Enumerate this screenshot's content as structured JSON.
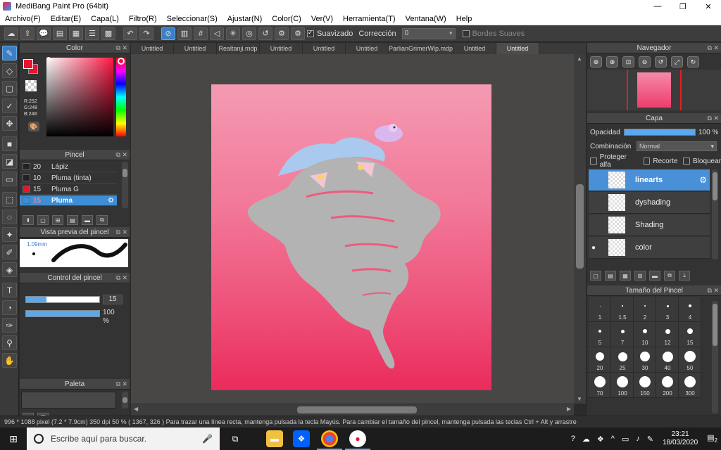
{
  "window": {
    "title": "MediBang Paint Pro (64bit)",
    "minimize": "—",
    "maximize": "❐",
    "close": "✕"
  },
  "menu": [
    "Archivo(F)",
    "Editar(E)",
    "Capa(L)",
    "Filtro(R)",
    "Seleccionar(S)",
    "Ajustar(N)",
    "Color(C)",
    "Ver(V)",
    "Herramienta(T)",
    "Ventana(W)",
    "Help"
  ],
  "toolbar": {
    "suavizado_label": "Suavizado",
    "correccion_label": "Corrección",
    "correccion_value": "0",
    "bordes_suaves_label": "Bordes Suaves"
  },
  "color_panel": {
    "title": "Color",
    "rgb_text": "R:252\nG:248\nB:248",
    "fg_color": "#e8132f"
  },
  "brush_panel": {
    "title": "Pincel",
    "brushes": [
      {
        "size": "20",
        "name": "Lápiz",
        "color": "#222222"
      },
      {
        "size": "10",
        "name": "Pluma (tinta)",
        "color": "#222222"
      },
      {
        "size": "15",
        "name": "Pluma G",
        "color": "#e8132f"
      },
      {
        "size": "15",
        "name": "Pluma",
        "color": "#3d8ed6"
      }
    ]
  },
  "brush_preview": {
    "title": "Vista previa del pincel",
    "size_text": "1.09mm"
  },
  "brush_control": {
    "title": "Control del pincel",
    "size_value": "15",
    "size_fraction": 0.28,
    "opacity_value": "100 %",
    "opacity_fraction": 1.0
  },
  "palette": {
    "title": "Paleta",
    "footer_text": "—"
  },
  "tabs": [
    "Untitled",
    "Untitled",
    "Realtanji.mdp",
    "Untitled",
    "Untitled",
    "Untitled",
    "ParlianGrimerWip.mdp",
    "Untitled",
    "Untitled"
  ],
  "navigator": {
    "title": "Navegador"
  },
  "layer_panel": {
    "title": "Capa",
    "opacity_label": "Opacidad",
    "opacity_value": "100 %",
    "blend_label": "Combinación",
    "blend_value": "Normal",
    "protect_alpha": "Proteger alfa",
    "clip": "Recorte",
    "lock": "Bloquear",
    "layers": [
      {
        "name": "linearts",
        "selected": true,
        "visible": false
      },
      {
        "name": "dyshading",
        "selected": false,
        "visible": false
      },
      {
        "name": "Shading",
        "selected": false,
        "visible": false
      },
      {
        "name": "color",
        "selected": false,
        "visible": true
      }
    ]
  },
  "brush_size_panel": {
    "title": "Tamaño del Pincel",
    "sizes": [
      "1",
      "1.5",
      "2",
      "3",
      "4",
      "5",
      "7",
      "10",
      "12",
      "15",
      "20",
      "25",
      "30",
      "40",
      "50",
      "70",
      "100",
      "150",
      "200",
      "300"
    ]
  },
  "status_bar": {
    "text": "996 * 1088 pixel   (7.2 * 7.9cm)   350 dpi   50 %   ( 1367, 326 )   Para trazar una línea recta, mantenga pulsada la tecla Mayús. Para cambiar el tamaño del pincel, mantenga pulsada las teclas Ctrl + Alt y arrastre"
  },
  "taskbar": {
    "search_placeholder": "Escribe aquí para buscar.",
    "time": "23:21",
    "date": "18/03/2020",
    "notification_count": "2"
  }
}
